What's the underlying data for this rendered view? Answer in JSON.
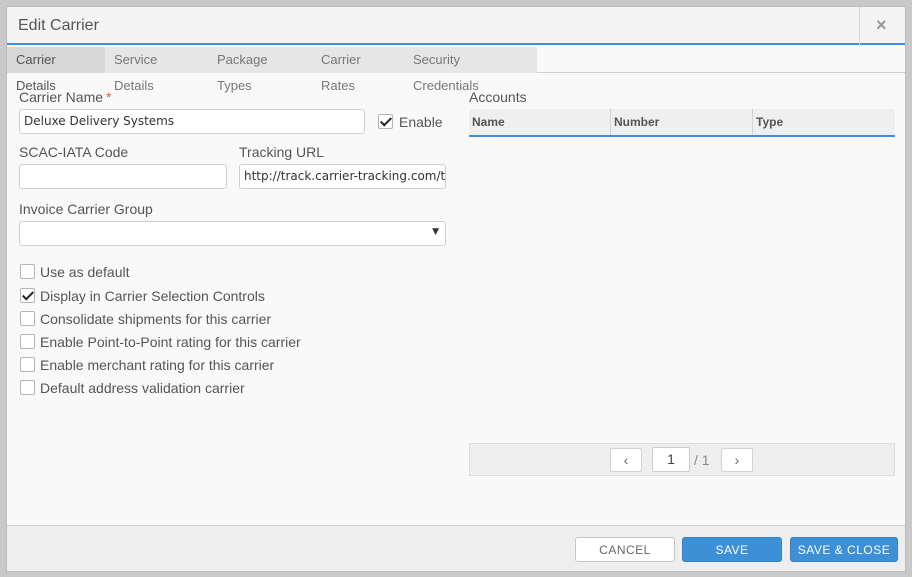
{
  "dialog": {
    "title": "Edit Carrier",
    "close_label": "×"
  },
  "tabs": [
    {
      "label": "Carrier Details",
      "active": true
    },
    {
      "label": "Service Details",
      "active": false
    },
    {
      "label": "Package Types",
      "active": false
    },
    {
      "label": "Carrier Rates",
      "active": false
    },
    {
      "label": "Security Credentials",
      "active": false
    }
  ],
  "form": {
    "carrier_name_label": "Carrier Name",
    "required_mark": "*",
    "carrier_name_value": "Deluxe Delivery Systems",
    "enable_label": "Enable",
    "enable_checked": true,
    "scac_label": "SCAC-IATA Code",
    "scac_value": "",
    "tracking_label": "Tracking URL",
    "tracking_value": "http://track.carrier-tracking.com/tra",
    "invoice_group_label": "Invoice Carrier Group",
    "invoice_group_value": "",
    "checkboxes": [
      {
        "label": "Use as default",
        "checked": false
      },
      {
        "label": "Display in Carrier Selection Controls",
        "checked": true
      },
      {
        "label": "Consolidate shipments for this carrier",
        "checked": false
      },
      {
        "label": "Enable Point-to-Point rating for this carrier",
        "checked": false
      },
      {
        "label": "Enable merchant rating for this carrier",
        "checked": false
      },
      {
        "label": "Default address validation carrier",
        "checked": false
      }
    ]
  },
  "accounts": {
    "title": "Accounts",
    "columns": [
      "Name",
      "Number",
      "Type"
    ],
    "rows": [],
    "pager": {
      "prev_icon": "chevron-left-icon",
      "next_icon": "chevron-right-icon",
      "page": "1",
      "total": "/ 1"
    }
  },
  "footer": {
    "cancel_label": "CANCEL",
    "save_label": "SAVE",
    "save_close_label": "SAVE & CLOSE"
  },
  "colors": {
    "accent": "#3d8fd6",
    "required": "#e35a4a"
  }
}
